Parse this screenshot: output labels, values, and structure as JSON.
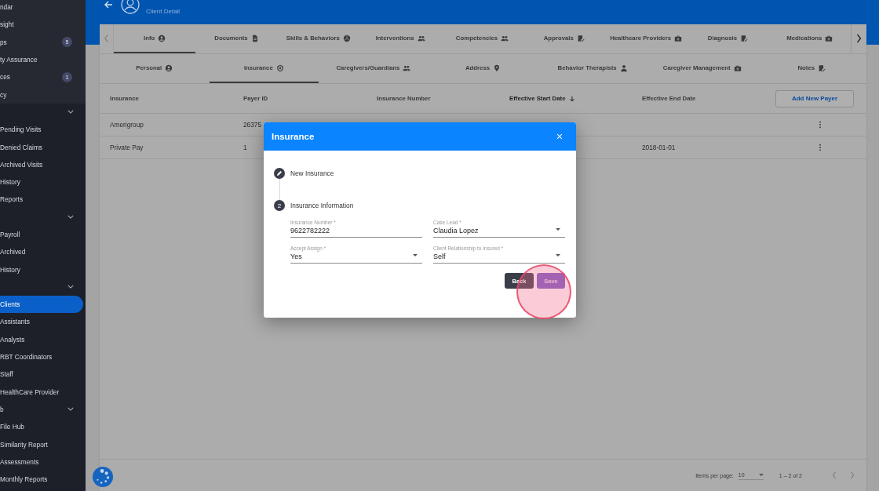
{
  "sidebar": {
    "items": [
      {
        "kind": "item",
        "label": "ndar",
        "selected": false,
        "top": true
      },
      {
        "kind": "item",
        "label": "sight",
        "selected": false,
        "top": true
      },
      {
        "kind": "item",
        "label": "ps",
        "selected": false,
        "top": true,
        "badge": "5"
      },
      {
        "kind": "item",
        "label": "ty Assurance",
        "selected": false,
        "top": true
      },
      {
        "kind": "item",
        "label": "ces",
        "selected": false,
        "top": true,
        "badge": "1"
      },
      {
        "kind": "item",
        "label": "cy",
        "selected": false,
        "top": true
      },
      {
        "kind": "section"
      },
      {
        "kind": "item",
        "label": "Pending Visits",
        "selected": false
      },
      {
        "kind": "item",
        "label": "Denied Claims",
        "selected": false
      },
      {
        "kind": "item",
        "label": "Archived Visits",
        "selected": false
      },
      {
        "kind": "item",
        "label": "History",
        "selected": false
      },
      {
        "kind": "item",
        "label": "Reports",
        "selected": false
      },
      {
        "kind": "section"
      },
      {
        "kind": "item",
        "label": "Payroll",
        "selected": false
      },
      {
        "kind": "item",
        "label": "Archived",
        "selected": false
      },
      {
        "kind": "item",
        "label": "History",
        "selected": false
      },
      {
        "kind": "section"
      },
      {
        "kind": "item",
        "label": "Clients",
        "selected": true
      },
      {
        "kind": "item",
        "label": "Assistants",
        "selected": false
      },
      {
        "kind": "item",
        "label": "Analysts",
        "selected": false
      },
      {
        "kind": "item",
        "label": "RBT Coordinators",
        "selected": false
      },
      {
        "kind": "item",
        "label": "Staff",
        "selected": false
      },
      {
        "kind": "item",
        "label": "HealthCare Provider",
        "selected": false
      },
      {
        "kind": "section",
        "label": "b"
      },
      {
        "kind": "item",
        "label": "File Hub",
        "selected": false
      },
      {
        "kind": "item",
        "label": "Similarity Report",
        "selected": false
      },
      {
        "kind": "item",
        "label": "Assessments",
        "selected": false
      },
      {
        "kind": "item",
        "label": "Monthly Reports",
        "selected": false
      }
    ]
  },
  "header": {
    "subtitle": "Client Detail"
  },
  "tabs": [
    {
      "label": "Info",
      "selected": true
    },
    {
      "label": "Documents",
      "selected": false
    },
    {
      "label": "Skills & Behaviors",
      "selected": false
    },
    {
      "label": "Interventions",
      "selected": false
    },
    {
      "label": "Competencies",
      "selected": false
    },
    {
      "label": "Approvals",
      "selected": false
    },
    {
      "label": "Healthcare Providers",
      "selected": false
    },
    {
      "label": "Diagnosis",
      "selected": false
    },
    {
      "label": "Medications",
      "selected": false
    }
  ],
  "subtabs": [
    {
      "label": "Personal",
      "selected": false
    },
    {
      "label": "Insurance",
      "selected": true
    },
    {
      "label": "Caregivers/Guardians",
      "selected": false
    },
    {
      "label": "Address",
      "selected": false
    },
    {
      "label": "Behavior Therapists",
      "selected": false
    },
    {
      "label": "Caregiver Management",
      "selected": false
    },
    {
      "label": "Notes",
      "selected": false
    }
  ],
  "table": {
    "columns": [
      {
        "label": "Insurance",
        "sorted": false
      },
      {
        "label": "Payer ID",
        "sorted": false
      },
      {
        "label": "Insurance Number",
        "sorted": false
      },
      {
        "label": "Effective Start Date",
        "sorted": true
      },
      {
        "label": "Effective End Date",
        "sorted": false
      }
    ],
    "add_button": "Add New Payer",
    "rows": [
      {
        "cells": [
          "Amerigroup",
          "26375",
          null,
          null,
          null
        ]
      },
      {
        "cells": [
          "Private Pay",
          "1",
          null,
          null,
          "2018-01-01"
        ]
      }
    ]
  },
  "paginator": {
    "label": "Items per page:",
    "page_size": "10",
    "range": "1 – 2 of 2"
  },
  "dialog": {
    "title": "Insurance",
    "steps": [
      {
        "kind": "edit",
        "label": "New Insurance"
      },
      {
        "kind": "number",
        "number": "2",
        "label": "Insurance Information"
      }
    ],
    "fields": [
      {
        "kind": "text",
        "label": "Insurance Number *",
        "value": "9622782222"
      },
      {
        "kind": "select",
        "label": "Case Lead *",
        "value": "Claudia Lopez"
      },
      {
        "kind": "select",
        "label": "Accept Assign *",
        "value": "Yes"
      },
      {
        "kind": "select",
        "label": "Client Relationship to Insured *",
        "value": "Self"
      }
    ],
    "buttons": [
      {
        "kind": "secondary",
        "label": "Back"
      },
      {
        "kind": "primary",
        "label": "Save"
      }
    ]
  }
}
